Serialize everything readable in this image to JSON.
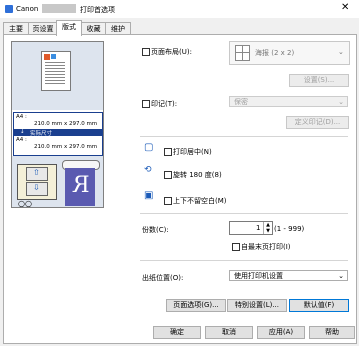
{
  "window": {
    "title_prefix": "Canon",
    "title_suffix": "打印首选项"
  },
  "tabs": [
    "主要",
    "页设置",
    "版式",
    "收藏",
    "维护"
  ],
  "preview": {
    "paper_line1_label": "A4 :",
    "paper_line1_size": "210.0 mm x 297.0 mm",
    "paper_mid_label": "实际尺寸",
    "paper_line2_label": "A4 :",
    "paper_line2_size": "210.0 mm x 297.0 mm"
  },
  "page_layout": {
    "label": "页面布局(U):",
    "value": "海报 (2 x 2)",
    "settings_button": "设置(S)..."
  },
  "stamp": {
    "label": "印记(T):",
    "value": "保密",
    "define_button": "定义印记(D)..."
  },
  "options": {
    "print_center": "打印居中(N)",
    "rotate_180": "旋转 180 度(8)",
    "flip_updown": "上下不留空白(M)"
  },
  "copies": {
    "label": "份数(C):",
    "value": "1",
    "range": "(1 - 999)",
    "last_page_first": "自最末页打印(I)"
  },
  "output": {
    "label": "出纸位置(O):",
    "value": "使用打印机设置"
  },
  "bottom_buttons": {
    "page_options": "页面选项(G)...",
    "special_settings": "特别设置(L)...",
    "defaults": "默认值(F)"
  },
  "dialog_buttons": {
    "ok": "确定",
    "cancel": "取消",
    "apply": "应用(A)",
    "help": "帮助"
  },
  "colors": {
    "accent": "#0078d7",
    "highlight": "#1a3f8f"
  }
}
